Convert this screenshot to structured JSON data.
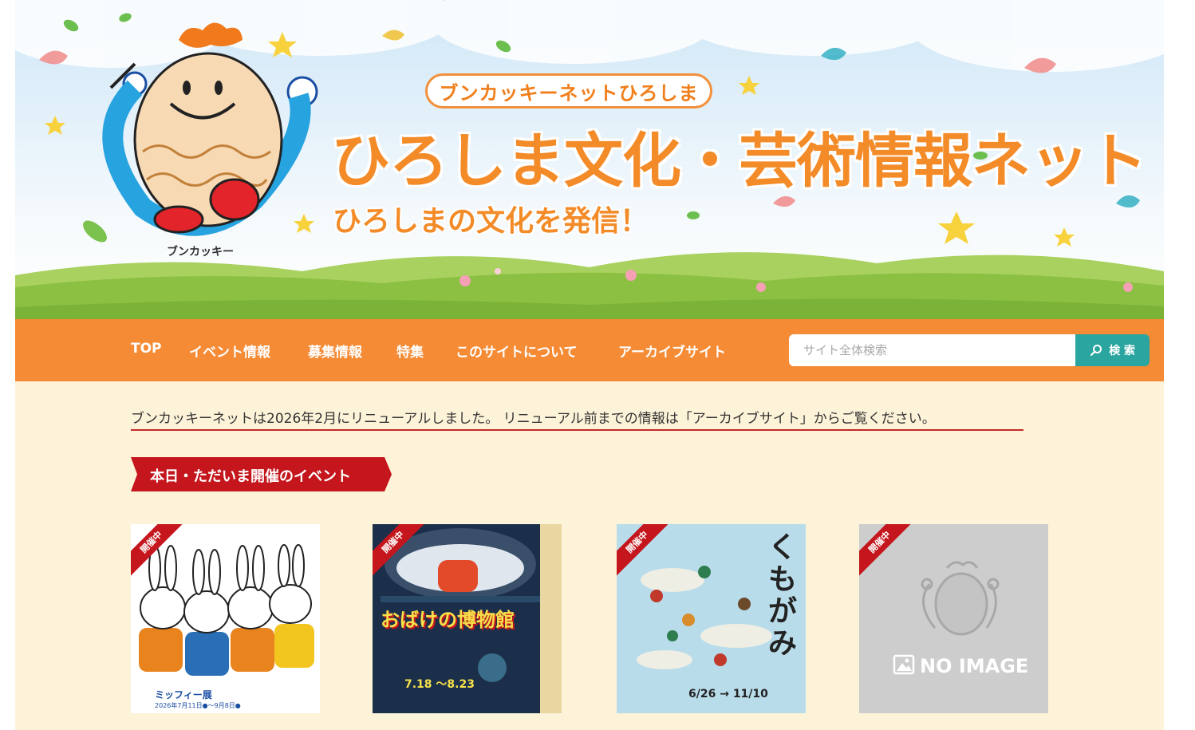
{
  "header": {
    "subtitle": "ブンカッキーネットひろしま",
    "title": "ひろしま文化・芸術情報ネット",
    "tagline": "ひろしまの文化を発信！",
    "mascot_name": "ブンカッキー"
  },
  "nav": {
    "items": [
      {
        "label": "TOP"
      },
      {
        "label": "イベント情報"
      },
      {
        "label": "募集情報"
      },
      {
        "label": "特集"
      },
      {
        "label": "このサイトについて"
      },
      {
        "label": "アーカイブサイト"
      }
    ],
    "search_placeholder": "サイト全体検索",
    "search_button": "検 索"
  },
  "notice": "ブンカッキーネットは2026年2月にリニューアルしました。 リニューアル前までの情報は「アーカイブサイト」からご覧ください。",
  "section": {
    "heading": "本日・ただいま開催のイベント"
  },
  "events": [
    {
      "badge": "開催中",
      "poster_title": "ミッフィー展",
      "poster_date": "2026年7月11日●～9月8日●"
    },
    {
      "badge": "開催中",
      "poster_title": "おばけの博物館",
      "poster_date": "7.18 ～8.23"
    },
    {
      "badge": "開催中",
      "poster_title": "くもがみ",
      "poster_date": "6/26 → 11/10"
    },
    {
      "badge": "開催中",
      "noimage": "NO IMAGE"
    }
  ],
  "colors": {
    "nav_bg": "#f58b35",
    "search_button": "#2aa59f",
    "heading_red": "#c4161c",
    "page_bg": "#fdf3d9",
    "title_orange": "#f38b28"
  }
}
